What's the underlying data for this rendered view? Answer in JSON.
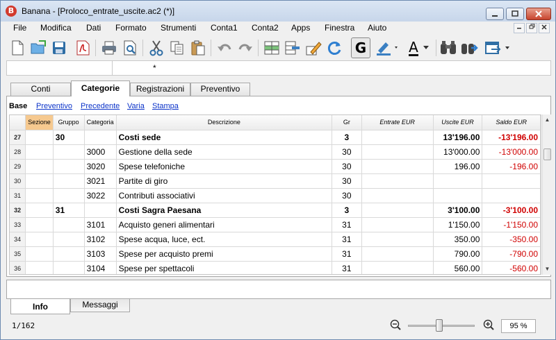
{
  "window": {
    "title": "Banana - [Proloco_entrate_uscite.ac2 (*)]",
    "app_icon_letter": "B",
    "controls": [
      "minimize",
      "maximize",
      "close"
    ]
  },
  "menu": {
    "items": [
      "File",
      "Modifica",
      "Dati",
      "Formato",
      "Strumenti",
      "Conta1",
      "Conta2",
      "Apps",
      "Finestra",
      "Aiuto"
    ],
    "mdi_controls": [
      "minimize",
      "restore",
      "close"
    ]
  },
  "toolbar": {
    "icons": [
      "new-file-icon",
      "open-folder-icon",
      "save-icon",
      "pdf-icon",
      "print-icon",
      "print-preview-icon",
      "cut-icon",
      "copy-icon",
      "paste-icon",
      "undo-icon",
      "redo-icon",
      "insert-row-icon",
      "delete-row-icon",
      "edit-pencil-icon",
      "refresh-icon",
      "bold-icon",
      "highlight-color-icon",
      "font-color-icon",
      "find-icon",
      "find-next-icon",
      "export-icon"
    ],
    "bold_label": "G",
    "font_color_label": "A"
  },
  "formula_bar": {
    "cell_ref": "",
    "value": "*"
  },
  "tabs": [
    {
      "label": "Conti",
      "active": false
    },
    {
      "label": "Categorie",
      "active": true
    },
    {
      "label": "Registrazioni",
      "active": false
    },
    {
      "label": "Preventivo",
      "active": false
    }
  ],
  "views": [
    {
      "label": "Base",
      "active": true
    },
    {
      "label": "Preventivo",
      "active": false
    },
    {
      "label": "Precedente",
      "active": false
    },
    {
      "label": "Varia",
      "active": false
    },
    {
      "label": "Stampa",
      "active": false
    }
  ],
  "table": {
    "headers": [
      "",
      "Sezione",
      "Gruppo",
      "Categoria",
      "Descrizione",
      "Gr",
      "Entrate EUR",
      "Uscite EUR",
      "Saldo EUR"
    ],
    "rows": [
      {
        "n": "27",
        "sez": "",
        "gruppo": "30",
        "cat": "",
        "desc": "Costi sede",
        "gr": "3",
        "entrate": "",
        "uscite": "13'196.00",
        "saldo": "-13'196.00",
        "bold": true
      },
      {
        "n": "28",
        "sez": "",
        "gruppo": "",
        "cat": "3000",
        "desc": "Gestione della sede",
        "gr": "30",
        "entrate": "",
        "uscite": "13'000.00",
        "saldo": "-13'000.00",
        "bold": false
      },
      {
        "n": "29",
        "sez": "",
        "gruppo": "",
        "cat": "3020",
        "desc": "Spese telefoniche",
        "gr": "30",
        "entrate": "",
        "uscite": "196.00",
        "saldo": "-196.00",
        "bold": false
      },
      {
        "n": "30",
        "sez": "",
        "gruppo": "",
        "cat": "3021",
        "desc": "Partite di giro",
        "gr": "30",
        "entrate": "",
        "uscite": "",
        "saldo": "",
        "bold": false
      },
      {
        "n": "31",
        "sez": "",
        "gruppo": "",
        "cat": "3022",
        "desc": "Contributi associativi",
        "gr": "30",
        "entrate": "",
        "uscite": "",
        "saldo": "",
        "bold": false
      },
      {
        "n": "32",
        "sez": "",
        "gruppo": "31",
        "cat": "",
        "desc": "Costi Sagra Paesana",
        "gr": "3",
        "entrate": "",
        "uscite": "3'100.00",
        "saldo": "-3'100.00",
        "bold": true
      },
      {
        "n": "33",
        "sez": "",
        "gruppo": "",
        "cat": "3101",
        "desc": "Acquisto generi alimentari",
        "gr": "31",
        "entrate": "",
        "uscite": "1'150.00",
        "saldo": "-1'150.00",
        "bold": false
      },
      {
        "n": "34",
        "sez": "",
        "gruppo": "",
        "cat": "3102",
        "desc": "Spese acqua, luce, ect.",
        "gr": "31",
        "entrate": "",
        "uscite": "350.00",
        "saldo": "-350.00",
        "bold": false
      },
      {
        "n": "35",
        "sez": "",
        "gruppo": "",
        "cat": "3103",
        "desc": "Spese per acquisto premi",
        "gr": "31",
        "entrate": "",
        "uscite": "790.00",
        "saldo": "-790.00",
        "bold": false
      },
      {
        "n": "36",
        "sez": "",
        "gruppo": "",
        "cat": "3104",
        "desc": "Spese per spettacoli",
        "gr": "31",
        "entrate": "",
        "uscite": "560.00",
        "saldo": "-560.00",
        "bold": false
      }
    ]
  },
  "bottom_tabs": [
    {
      "label": "Info",
      "active": true
    },
    {
      "label": "Messaggi",
      "active": false
    }
  ],
  "status": {
    "position": "1/162",
    "zoom": "95 %",
    "zoom_level": 0.43
  },
  "colors": {
    "negative": "#d00000",
    "link": "#0b33c9",
    "section_header": "#f6c98f"
  }
}
